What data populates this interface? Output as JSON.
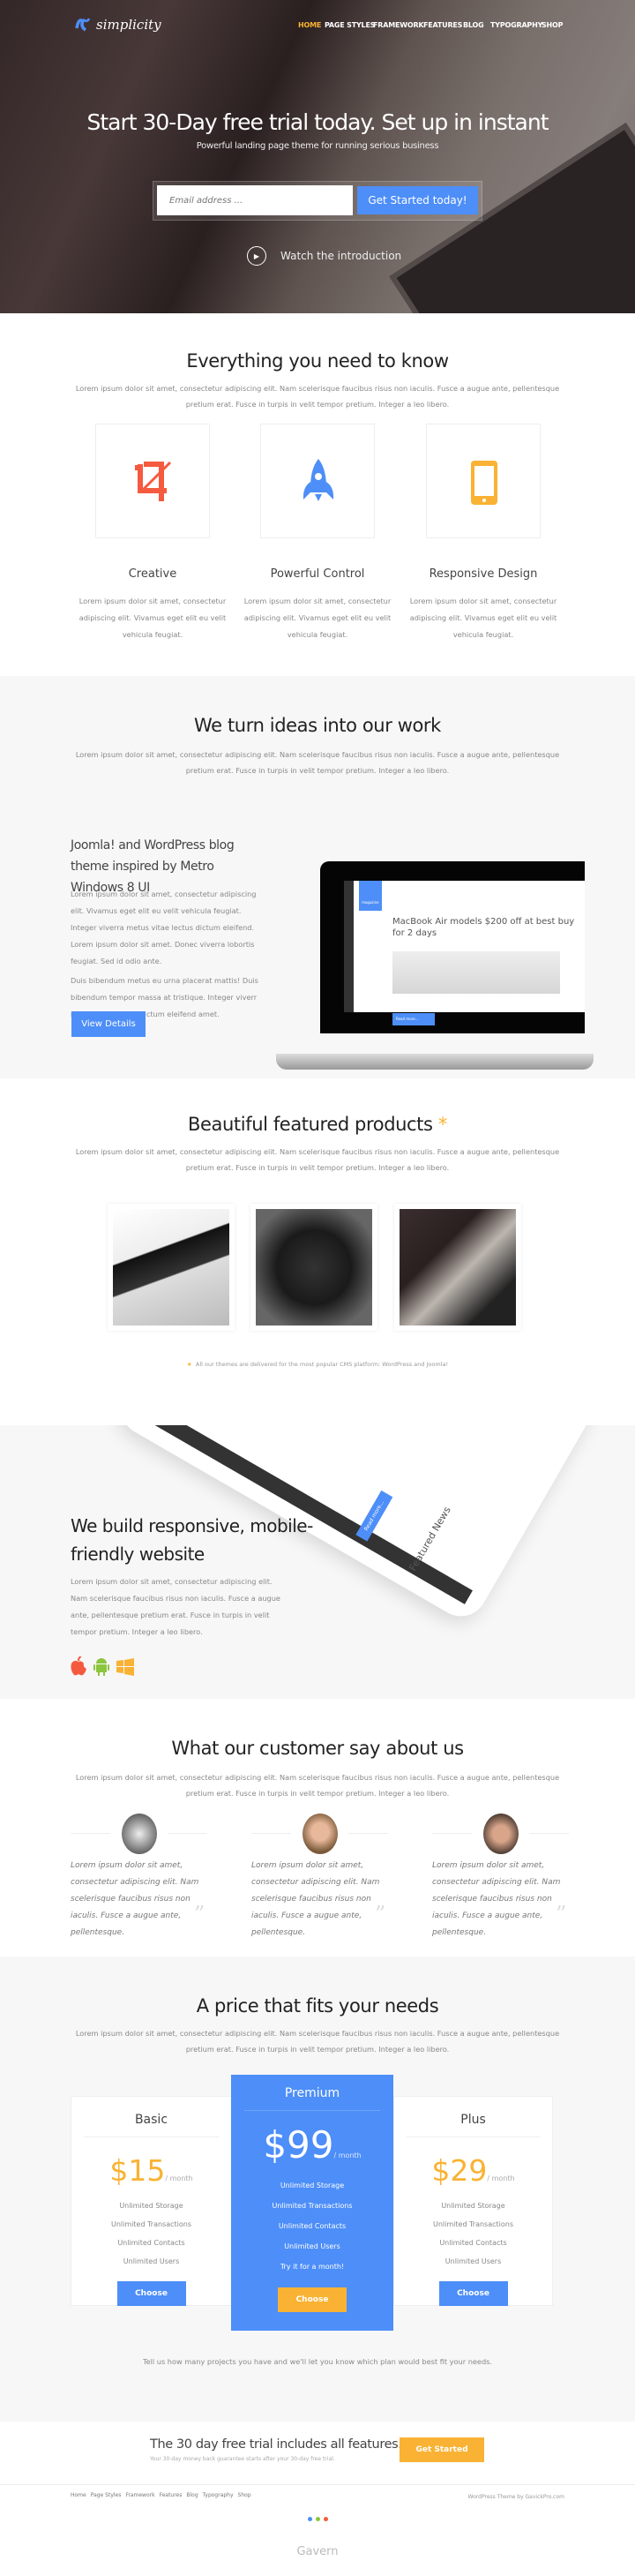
{
  "header": {
    "logo": "simplicity",
    "nav": [
      "HOME",
      "PAGE STYLES",
      "FRAMEWORK",
      "FEATURES",
      "BLOG",
      "TYPOGRAPHY",
      "SHOP"
    ],
    "active_color": "#f9b233"
  },
  "hero": {
    "title": "Start 30-Day free trial today. Set up in instant",
    "subtitle": "Powerful landing page theme for running serious business",
    "email_placeholder": "Email address ...",
    "cta": "Get Started today!",
    "watch": "Watch the introduction"
  },
  "features": {
    "title": "Everything you need to know",
    "lead": "Lorem ipsum dolor sit amet, consectetur adipiscing elit. Nam scelerisque faucibus risus non iaculis. Fusce a augue ante, pellentesque pretium erat. Fusce in turpis in velit tempor pretium. Integer a leo libero.",
    "items": [
      {
        "icon": "crop-icon",
        "color": "#f55a3f",
        "title": "Creative",
        "desc": "Lorem ipsum dolor sit amet, consectetur adipiscing elit. Vivamus eget elit eu velit vehicula feugiat."
      },
      {
        "icon": "rocket-icon",
        "color": "#4d8ef8",
        "title": "Powerful Control",
        "desc": "Lorem ipsum dolor sit amet, consectetur adipiscing elit. Vivamus eget elit eu velit vehicula feugiat."
      },
      {
        "icon": "smartphone-icon",
        "color": "#f9b233",
        "title": "Responsive Design",
        "desc": "Lorem ipsum dolor sit amet, consectetur adipiscing elit. Vivamus eget elit eu velit vehicula feugiat."
      }
    ]
  },
  "ideas": {
    "title": "We turn ideas into our work",
    "lead": "Lorem ipsum dolor sit amet, consectetur adipiscing elit. Nam scelerisque faucibus risus non iaculis. Fusce a augue ante, pellentesque pretium erat. Fusce in turpis in velit tempor pretium. Integer a leo libero.",
    "heading": "Joomla! and WordPress blog theme inspired by Metro Windows 8 UI",
    "p1": "Lorem ipsum dolor sit amet, consectetur adipiscing elit. Vivamus eget elit eu velit vehicula feugiat. Integer viverra metus vitae lectus dictum eleifend. Lorem ipsum dolor sit amet. Donec viverra lobortis feugiat. Sed id odio ante.",
    "p2": "Duis bibendum metus eu urna placerat mattis! Duis bibendum tempor massa at tristique. Integer viverr metus vitae lectus dictum eleifend amet.",
    "button": "View Details",
    "screen": {
      "brand": "magazine",
      "headline": "MacBook Air models $200 off at best buy for 2 days",
      "read_more": "Read more..."
    }
  },
  "products": {
    "title": "Beautiful featured products",
    "star": "*",
    "lead": "Lorem ipsum dolor sit amet, consectetur adipiscing elit. Nam scelerisque faucibus risus non iaculis. Fusce a augue ante, pellentesque pretium erat. Fusce in turpis in velit tempor pretium. Integer a leo libero.",
    "note": "All our themes are delivered for the most popular CMS platform: WordPress and Joomla!"
  },
  "responsive": {
    "title": "We build responsive, mobile-friendly website",
    "text": "Lorem ipsum dolor sit amet, consectetur adipiscing elit. Nam scelerisque faucibus risus non iaculis. Fusce a augue ante, pellentesque pretium erat. Fusce in turpis in velit tempor pretium. Integer a leo libero.",
    "tablet": {
      "featured": "Featured News",
      "read_more": "Read more..."
    },
    "platforms": [
      "apple-icon",
      "android-icon",
      "windows-icon"
    ]
  },
  "testimonials": {
    "title": "What our customer say about us",
    "lead": "Lorem ipsum dolor sit amet, consectetur adipiscing elit. Nam scelerisque faucibus risus non iaculis. Fusce a augue ante, pellentesque pretium erat. Fusce in turpis in velit tempor pretium. Integer a leo libero.",
    "quotes": [
      "Lorem ipsum dolor sit amet, consectetur adipiscing elit. Nam scelerisque faucibus risus non iaculis. Fusce a augue ante, pellentesque.",
      "Lorem ipsum dolor sit amet, consectetur adipiscing elit. Nam scelerisque faucibus risus non iaculis. Fusce a augue ante, pellentesque.",
      "Lorem ipsum dolor sit amet, consectetur adipiscing elit. Nam scelerisque faucibus risus non iaculis. Fusce a augue ante, pellentesque."
    ]
  },
  "pricing": {
    "title": "A price that fits your needs",
    "lead": "Lorem ipsum dolor sit amet, consectetur adipiscing elit. Nam scelerisque faucibus risus non iaculis. Fusce a augue ante, pellentesque pretium erat. Fusce in turpis in velit tempor pretium. Integer a leo libero.",
    "plans": [
      {
        "name": "Basic",
        "price": "$15",
        "per": "/ month",
        "features": [
          "Unlimited Storage",
          "Unlimited Transactions",
          "Unlimited Contacts",
          "Unlimited Users"
        ],
        "button": "Choose"
      },
      {
        "name": "Premium",
        "price": "$99",
        "per": "/ month",
        "features": [
          "Unlimited Storage",
          "Unlimited Transactions",
          "Unlimited Contacts",
          "Unlimited Users",
          "Try it for a month!"
        ],
        "button": "Choose"
      },
      {
        "name": "Plus",
        "price": "$29",
        "per": "/ month",
        "features": [
          "Unlimited Storage",
          "Unlimited Transactions",
          "Unlimited Contacts",
          "Unlimited Users"
        ],
        "button": "Choose"
      }
    ],
    "note": "Tell us how many projects you have and we'll let you know which plan would best fit your needs."
  },
  "cta": {
    "title": "The 30 day free trial includes all features.",
    "sub": "Your 30-day money back guarantee starts after your 30-day free trial.",
    "button": "Get Started"
  },
  "footer": {
    "links": [
      "Home",
      "Page Styles",
      "Framework",
      "Features",
      "Blog",
      "Typography",
      "Shop"
    ],
    "credit": "WordPress Theme by GavickPro.com",
    "logo": "Gavern"
  },
  "colors": {
    "blue": "#4d8ef8",
    "orange": "#f9b233",
    "red": "#f55a3f",
    "gray_bg": "#f7f7f7"
  }
}
